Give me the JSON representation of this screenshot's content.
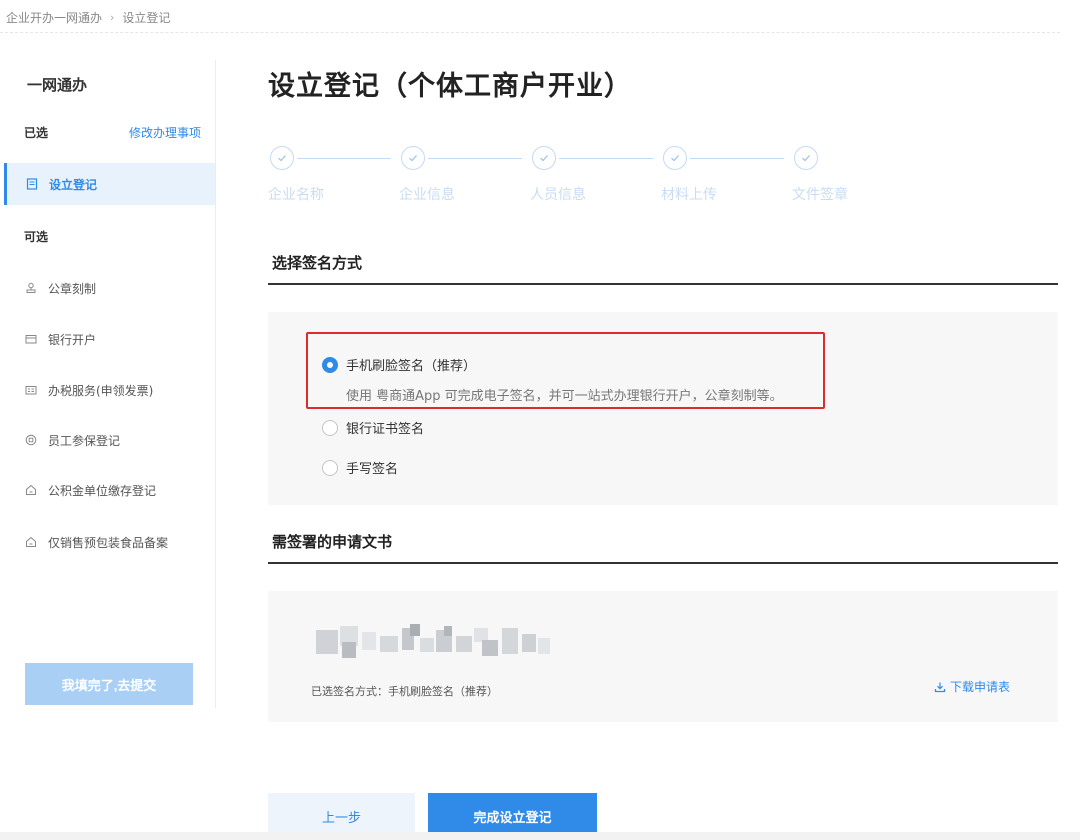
{
  "breadcrumb": {
    "root": "企业开办一网通办",
    "sep": "›",
    "current": "设立登记"
  },
  "sidebar": {
    "title": "一网通办",
    "selected_label": "已选",
    "modify_link": "修改办理事项",
    "active_item": {
      "label": "设立登记",
      "icon": "document-icon"
    },
    "optional_label": "可选",
    "items": [
      {
        "label": "公章刻制",
        "icon": "stamp-icon"
      },
      {
        "label": "银行开户",
        "icon": "card-icon"
      },
      {
        "label": "办税服务(申领发票)",
        "icon": "invoice-icon"
      },
      {
        "label": "员工参保登记",
        "icon": "shield-icon"
      },
      {
        "label": "公积金单位缴存登记",
        "icon": "building-icon"
      },
      {
        "label": "仅销售预包装食品备案",
        "icon": "building-icon"
      }
    ],
    "submit_button": "我填完了,去提交"
  },
  "main": {
    "title": "设立登记（个体工商户开业）",
    "steps": [
      "企业名称",
      "企业信息",
      "人员信息",
      "材料上传",
      "文件签章"
    ],
    "sign_section_title": "选择签名方式",
    "sign_options": [
      {
        "label": "手机刷脸签名（推荐）",
        "selected": true
      },
      {
        "label": "银行证书签名",
        "selected": false
      },
      {
        "label": "手写签名",
        "selected": false
      }
    ],
    "sign_description": "使用 粤商通App 可完成电子签名，并可一站式办理银行开户，公章刻制等。",
    "docs_section_title": "需签署的申请文书",
    "selected_method_text": "已选签名方式：手机刷脸签名（推荐）",
    "download_link": "下载申请表",
    "prev_button": "上一步",
    "complete_button": "完成设立登记"
  },
  "colors": {
    "accent": "#2f8ae8",
    "highlight_border": "#e02b2b",
    "step_inactive": "#c8ddf2"
  }
}
